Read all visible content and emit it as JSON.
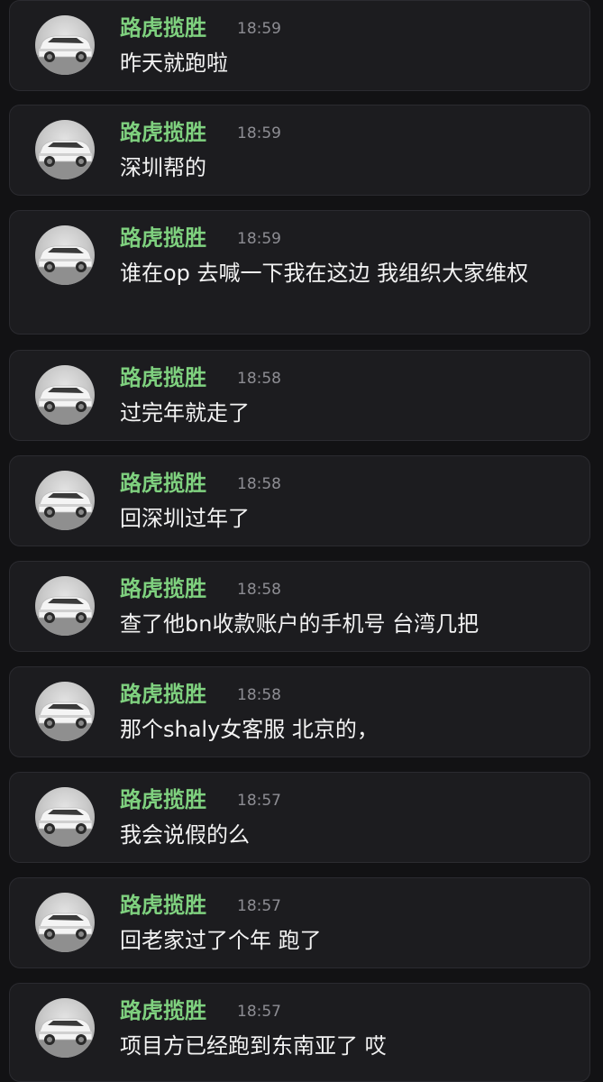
{
  "messages": [
    {
      "sender": "路虎揽胜",
      "time": "18:59",
      "text": "昨天就跑啦"
    },
    {
      "sender": "路虎揽胜",
      "time": "18:59",
      "text": "深圳帮的"
    },
    {
      "sender": "路虎揽胜",
      "time": "18:59",
      "text": "谁在op 去喊一下我在这边 我组织大家维权"
    },
    {
      "sender": "路虎揽胜",
      "time": "18:58",
      "text": "过完年就走了"
    },
    {
      "sender": "路虎揽胜",
      "time": "18:58",
      "text": "回深圳过年了"
    },
    {
      "sender": "路虎揽胜",
      "time": "18:58",
      "text": "查了他bn收款账户的手机号  台湾几把"
    },
    {
      "sender": "路虎揽胜",
      "time": "18:58",
      "text": "那个shaly女客服 北京的，"
    },
    {
      "sender": "路虎揽胜",
      "time": "18:57",
      "text": "我会说假的么"
    },
    {
      "sender": "路虎揽胜",
      "time": "18:57",
      "text": "回老家过了个年 跑了"
    },
    {
      "sender": "路虎揽胜",
      "time": "18:57",
      "text": "项目方已经跑到东南亚了 哎"
    }
  ],
  "avatar_icon": "white-suv-car-icon",
  "colors": {
    "background": "#121214",
    "card": "#1c1c1f",
    "sender": "#7fd17f",
    "time": "#8d8d93",
    "text": "#f2f2f2"
  }
}
